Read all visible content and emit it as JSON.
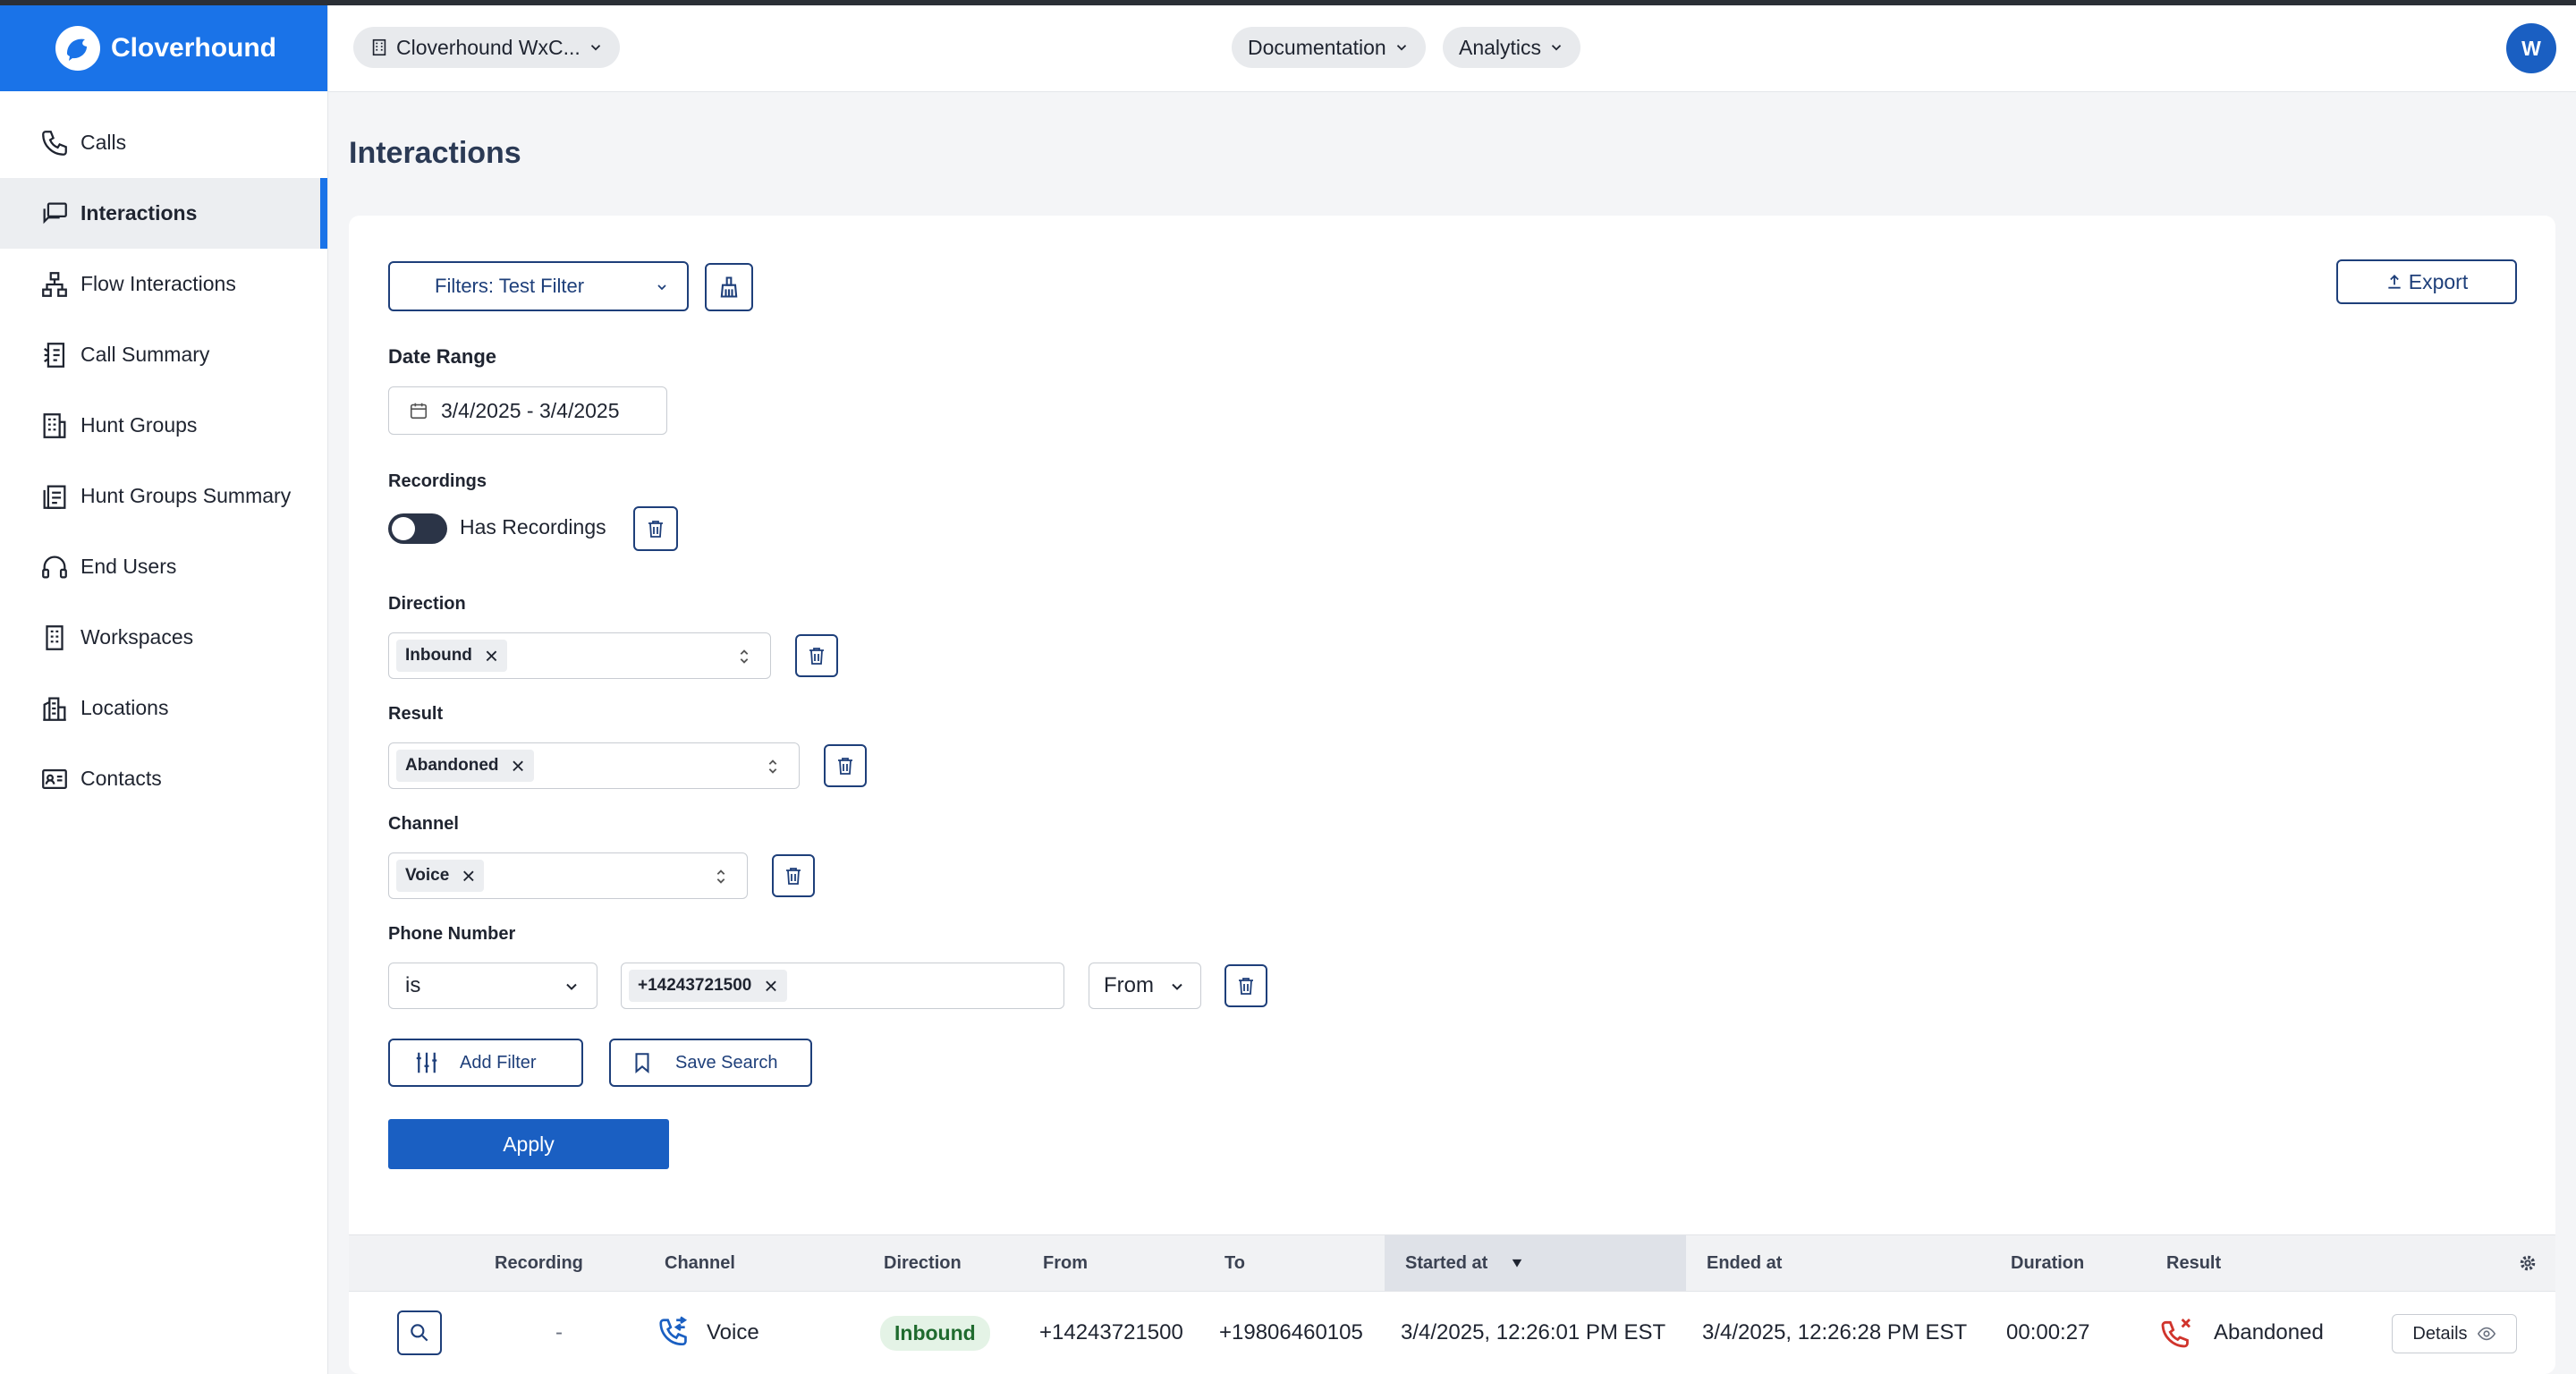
{
  "app": {
    "name": "Cloverhound"
  },
  "sidebar": {
    "items": [
      {
        "label": "Calls",
        "icon": "phone-icon"
      },
      {
        "label": "Interactions",
        "icon": "chat-icon",
        "active": true
      },
      {
        "label": "Flow Interactions",
        "icon": "flow-icon"
      },
      {
        "label": "Call Summary",
        "icon": "call-summary-icon"
      },
      {
        "label": "Hunt Groups",
        "icon": "building-icon"
      },
      {
        "label": "Hunt Groups Summary",
        "icon": "clipboard-icon"
      },
      {
        "label": "End Users",
        "icon": "headset-icon"
      },
      {
        "label": "Workspaces",
        "icon": "building-icon"
      },
      {
        "label": "Locations",
        "icon": "location-building-icon"
      },
      {
        "label": "Contacts",
        "icon": "contact-card-icon"
      }
    ]
  },
  "header": {
    "org": "Cloverhound WxC...",
    "documentation": "Documentation",
    "analytics": "Analytics",
    "avatar": "W"
  },
  "page": {
    "title": "Interactions"
  },
  "filters": {
    "saved_filter": "Filters: Test Filter",
    "export": "Export",
    "date_range": {
      "label": "Date Range",
      "value": "3/4/2025 - 3/4/2025"
    },
    "recordings": {
      "label": "Recordings",
      "toggle_label": "Has Recordings",
      "enabled": false
    },
    "direction": {
      "label": "Direction",
      "chip": "Inbound"
    },
    "result": {
      "label": "Result",
      "chip": "Abandoned"
    },
    "channel": {
      "label": "Channel",
      "chip": "Voice"
    },
    "phone_number": {
      "label": "Phone Number",
      "operator": "is",
      "chip": "+14243721500",
      "field": "From"
    },
    "add_filter": "Add Filter",
    "save_search": "Save Search",
    "apply": "Apply"
  },
  "table": {
    "columns": [
      "Recording",
      "Channel",
      "Direction",
      "From",
      "To",
      "Started at",
      "Ended at",
      "Duration",
      "Result"
    ],
    "sorted_column": "Started at",
    "sort_direction": "desc",
    "rows": [
      {
        "recording": "-",
        "channel": "Voice",
        "direction": "Inbound",
        "from": "+14243721500",
        "to": "+19806460105",
        "started_at": "3/4/2025, 12:26:01 PM EST",
        "ended_at": "3/4/2025, 12:26:28 PM EST",
        "duration": "00:00:27",
        "result": "Abandoned",
        "details": "Details"
      }
    ]
  },
  "colors": {
    "brand": "#1a73e8",
    "primary_button": "#1a5fc2",
    "outline": "#1e3f7a",
    "success_badge": "#e4f3e6",
    "abandoned": "#d0342c"
  }
}
